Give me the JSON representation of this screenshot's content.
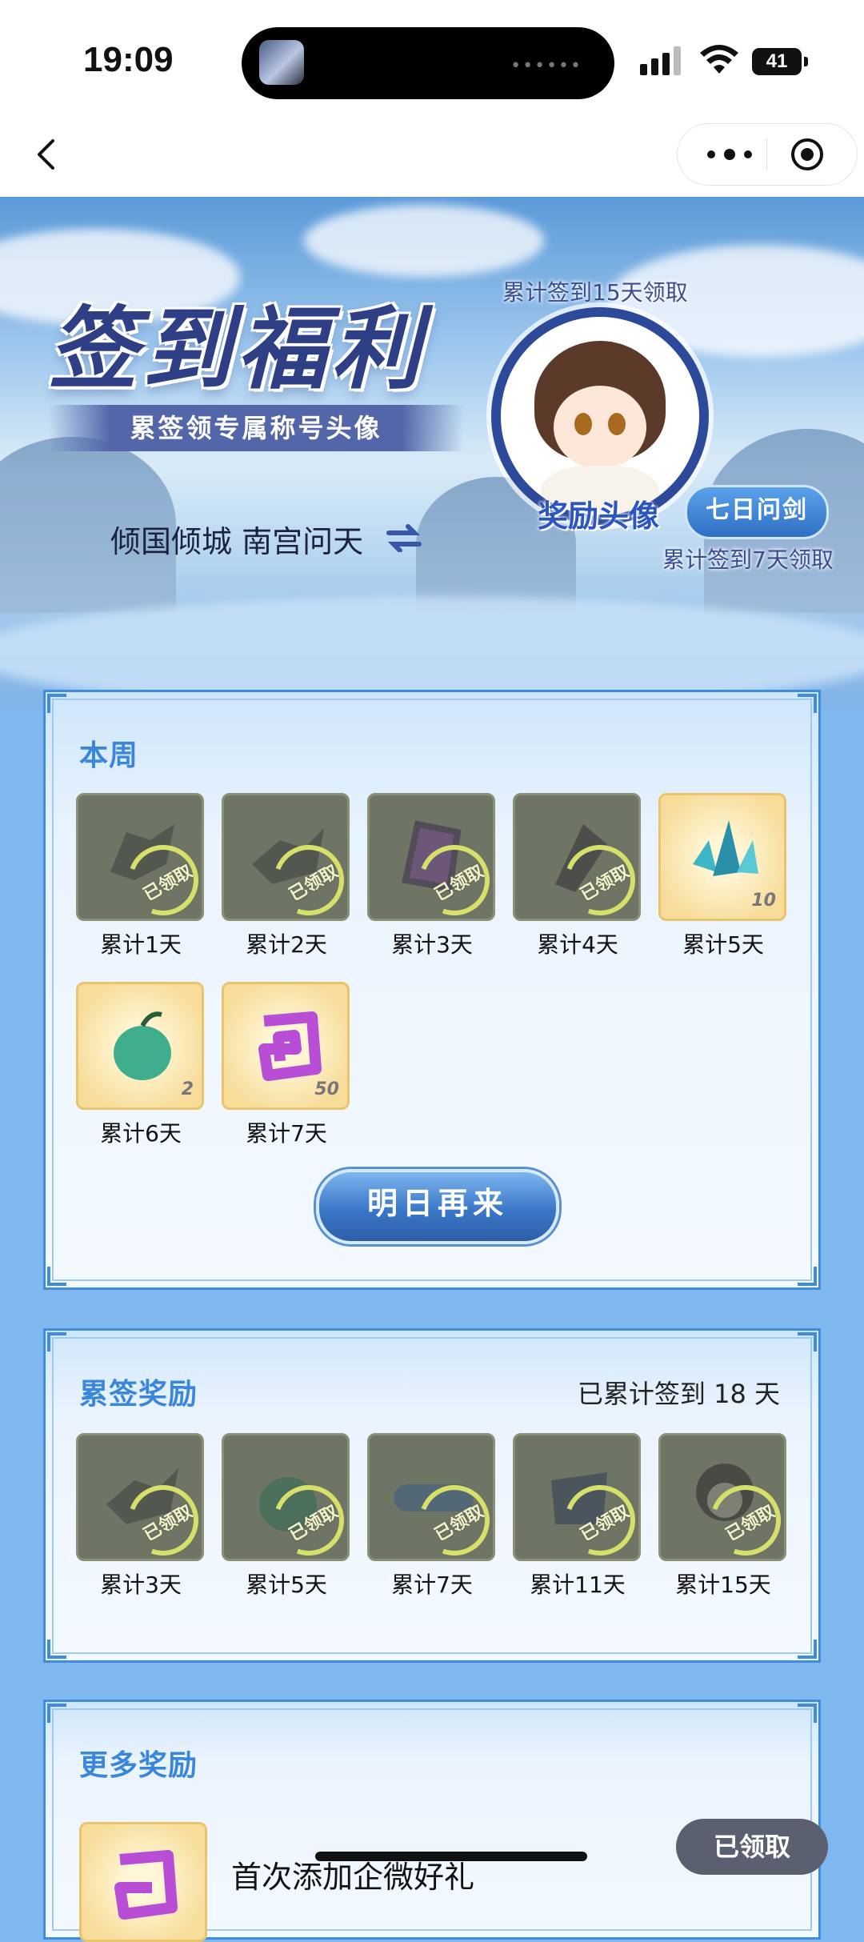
{
  "status_bar": {
    "time": "19:09",
    "battery": "41"
  },
  "banner": {
    "title": "签到福利",
    "subtitle": "累签领专属称号头像",
    "user_line": "倾国倾城 南宫问天",
    "avatar_caption": "累计签到15天领取",
    "avatar_label": "奖励头像",
    "title_badge": "七日问剑",
    "title_badge_caption": "累计签到7天领取"
  },
  "weekly": {
    "title": "本周",
    "items": [
      {
        "label": "累计1天",
        "state": "claimed",
        "stamp": "已领取",
        "icon": "sword-shard-icon",
        "qty": ""
      },
      {
        "label": "累计2天",
        "state": "claimed",
        "stamp": "已领取",
        "icon": "sword-shard-icon",
        "qty": ""
      },
      {
        "label": "累计3天",
        "state": "claimed",
        "stamp": "已领取",
        "icon": "purple-frame-icon",
        "qty": ""
      },
      {
        "label": "累计4天",
        "state": "claimed",
        "stamp": "已领取",
        "icon": "dark-crystal-icon",
        "qty": ""
      },
      {
        "label": "累计5天",
        "state": "open",
        "stamp": "",
        "icon": "blue-crystal-icon",
        "qty": "10"
      },
      {
        "label": "累计6天",
        "state": "open",
        "stamp": "",
        "icon": "green-fruit-icon",
        "qty": "2"
      },
      {
        "label": "累计7天",
        "state": "open",
        "stamp": "",
        "icon": "purple-rune-icon",
        "qty": "50"
      }
    ],
    "button": "明日再来"
  },
  "cumulative": {
    "title": "累签奖励",
    "summary": "已累计签到 18 天",
    "items": [
      {
        "label": "累计3天",
        "stamp": "已领取",
        "icon": "sword-shard-icon"
      },
      {
        "label": "累计5天",
        "stamp": "已领取",
        "icon": "green-fruit-icon"
      },
      {
        "label": "累计7天",
        "stamp": "已领取",
        "icon": "title-badge-icon"
      },
      {
        "label": "累计11天",
        "stamp": "已领取",
        "icon": "armor-icon"
      },
      {
        "label": "累计15天",
        "stamp": "已领取",
        "icon": "avatar-icon"
      }
    ]
  },
  "more": {
    "title": "更多奖励",
    "first_item": "首次添加企微好礼",
    "first_button": "已领取"
  },
  "colors": {
    "accent": "#3b86dd",
    "card_border": "#3e8be0",
    "claimed_tile": "#6f7564",
    "open_tile": "#f7dc9a"
  }
}
